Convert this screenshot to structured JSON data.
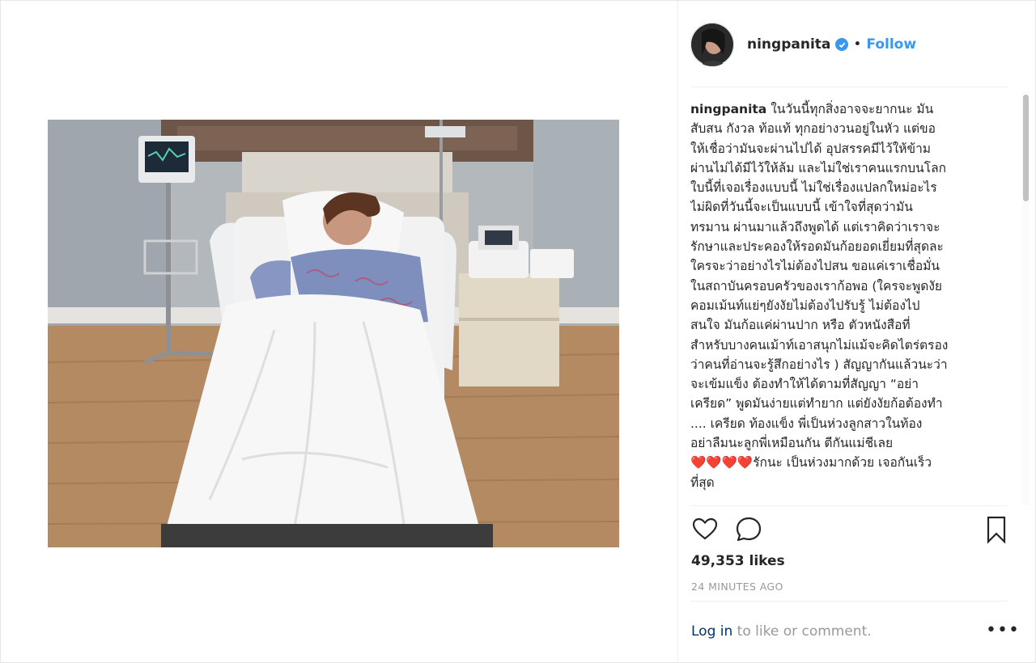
{
  "header": {
    "username": "ningpanita",
    "separator": "•",
    "follow_label": "Follow"
  },
  "caption": {
    "username": "ningpanita",
    "lines": [
      "ในวันนี้ทุกสิ่งอาจจะยากนะ มัน",
      "สับสน กังวล ท้อแท้ ทุกอย่างวนอยู่ในหัว แต่ขอ",
      "ให้เชื่อว่ามันจะผ่านไปได้ อุปสรรคมีไว้ให้ข้าม",
      "ผ่านไม่ได้มีไว้ให้ล้ม และไม่ใช่เราคนแรกบนโลก",
      "ใบนี้ที่เจอเรื่องแบบนี้ ไม่ใช่เรื่องแปลกใหม่อะไร",
      "ไม่ผิดที่วันนี้จะเป็นแบบนี้ เข้าใจที่สุดว่ามัน",
      "ทรมาน ผ่านมาแล้วถึงพูดได้ แต่เราคิดว่าเราจะ",
      "รักษาและประคองให้รอดมันก้อยอดเยี่ยมที่สุดละ",
      "ใครจะว่าอย่างไรไม่ต้องไปสน ขอแค่เราเชื่อมั่น",
      "ในสถาบันครอบครัวของเราก้อพอ (ใครจะพูดงัย",
      "คอมเม้นท์แย่ๆยังงัยไม่ต้องไปรับรู้ ไม่ต้องไป",
      "สนใจ มันก้อแค่ผ่านปาก หรือ ตัวหนังสือที่",
      "สำหรับบางคนเม้าท์เอาสนุกไม่แม้จะคิดไตร่ตรอง",
      "ว่าคนที่อ่านจะรู้สึกอย่างไร ) สัญญากันแล้วนะว่า",
      "จะเข้มแข็ง ต้องทำให้ได้ตามที่สัญญา “อย่า",
      "เครียด” พูดมันง่ายแต่ทำยาก แต่ยังงัยก้อต้องทำ",
      ".... เครียด ท้องแข็ง พี่เป็นห่วงลูกสาวในท้อง",
      "อย่าลืมนะลูกพี่เหมือนกัน ตีกันแม่ชีเลย",
      "❤️❤️❤️❤️รักนะ เป็นห่วงมากด้วย เจอกันเร็ว",
      "ที่สุด"
    ]
  },
  "stats": {
    "likes": "49,353 likes",
    "time_ago": "24 MINUTES AGO"
  },
  "footer": {
    "login_label": "Log in",
    "login_suffix": " to like or comment.",
    "more_label": "•••"
  },
  "icons": {
    "like": "heart-outline-icon",
    "comment": "comment-bubble-icon",
    "save": "bookmark-outline-icon",
    "verified": "verified-badge-icon"
  },
  "colors": {
    "accent": "#3897f0",
    "link_dark": "#003569",
    "muted": "#999999"
  }
}
